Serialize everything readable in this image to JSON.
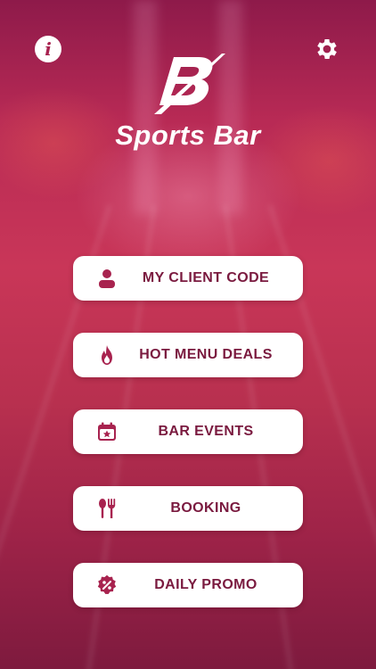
{
  "app": {
    "brand_name": "Sports Bar",
    "brand_letter": "B"
  },
  "header": {
    "info_glyph": "i",
    "info_icon": "info-icon",
    "settings_icon": "gear-icon"
  },
  "menu": {
    "items": [
      {
        "label": "MY CLIENT CODE",
        "icon": "user-icon"
      },
      {
        "label": "HOT MENU DEALS",
        "icon": "flame-icon"
      },
      {
        "label": "BAR EVENTS",
        "icon": "calendar-star-icon"
      },
      {
        "label": "BOOKING",
        "icon": "fork-spoon-icon"
      },
      {
        "label": "DAILY PROMO",
        "icon": "percent-badge-icon"
      }
    ]
  },
  "colors": {
    "accent": "#a8234f",
    "button_bg": "#ffffff",
    "label": "#7a1a3f"
  }
}
